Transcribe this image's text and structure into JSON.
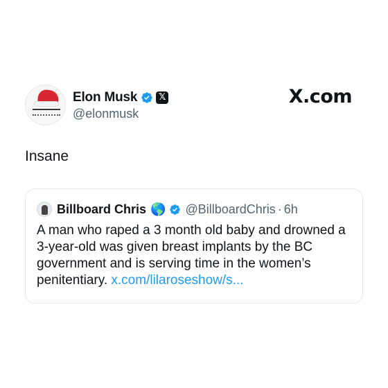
{
  "tweet": {
    "author": {
      "display_name": "Elon Musk",
      "handle": "@elonmusk",
      "verified_icon": "verified-badge-icon",
      "affiliation_icon": "x-logo-icon"
    },
    "text": "Insane"
  },
  "brand": {
    "label": "X.com"
  },
  "quoted_tweet": {
    "author": {
      "display_name": "Billboard Chris",
      "emoji": "🌎",
      "handle": "@BillboardChris",
      "separator": "·",
      "time": "6h"
    },
    "body": "A man who raped a 3 month old baby and drowned a 3-year-old was given breast implants by the BC government and is serving time in the women’s penitentiary.",
    "link_text": "x.com/lilaroseshow/s..."
  },
  "colors": {
    "verified_blue": "#1d9bf0",
    "text_primary": "#0f1419",
    "text_secondary": "#536471",
    "border": "#e5e7ea"
  }
}
